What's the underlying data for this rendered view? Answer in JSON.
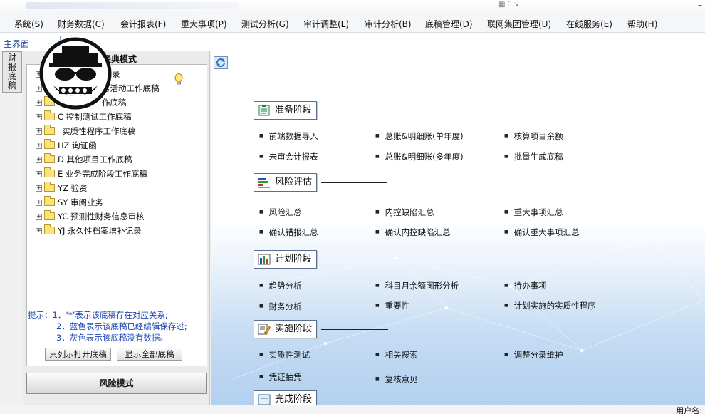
{
  "menu": {
    "items": [
      "系统(S)",
      "财务数据(C)",
      "会计报表(F)",
      "重大事项(P)",
      "测试分析(G)",
      "审计调整(L)",
      "审计分析(B)",
      "底稿管理(D)",
      "联网集团管理(U)",
      "在线服务(E)",
      "帮助(H)"
    ]
  },
  "tabs": {
    "main": "主界面"
  },
  "side_tab": {
    "chars": [
      "财",
      "报",
      "底",
      "稿"
    ]
  },
  "left_panel": {
    "header": "经典模式",
    "tree": [
      "录",
      "务活动工作底稿",
      "作底稿",
      "C 控制测试工作底稿",
      "实质性程序工作底稿",
      "HZ 询证函",
      "D 其他项目工作底稿",
      "E 业务完成阶段工作底稿",
      "YZ 验资",
      "SY 审阅业务",
      "YC 预测性财务信息审核",
      "YJ 永久性档案增补记录"
    ],
    "hints": [
      "提示：1．‘*’表示该底稿存在对应关系;",
      "2．蓝色表示该底稿已经编辑保存过;",
      "3．灰色表示该底稿没有数据。"
    ],
    "btn_open": "只列示打开底稿",
    "btn_all": "显示全部底稿",
    "risk_mode": "风险模式"
  },
  "sections": {
    "prepare": {
      "title": "准备阶段",
      "links": [
        "前端数据导入",
        "总账&明细账(单年度)",
        "核算项目余额",
        "未审会计报表",
        "总账&明细账(多年度)",
        "批量生成底稿"
      ]
    },
    "risk": {
      "title": "风险评估",
      "links": [
        "风险汇总",
        "内控缺陷汇总",
        "重大事项汇总",
        "确认错报汇总",
        "确认内控缺陷汇总",
        "确认重大事项汇总"
      ]
    },
    "plan": {
      "title": "计划阶段",
      "links": [
        "趋势分析",
        "科目月余额图形分析",
        "待办事项",
        "财务分析",
        "重要性",
        "计划实施的实质性程序"
      ]
    },
    "execute": {
      "title": "实施阶段",
      "links": [
        "实质性测试",
        "相关搜索",
        "调整分录维护",
        "凭证抽凭",
        "复核意见"
      ]
    },
    "complete": {
      "title": "完成阶段"
    }
  },
  "status": {
    "user_label": "用户名:"
  },
  "colors": {
    "hint_blue": "#1d45b8",
    "main_gradient_end": "#b3d0ef"
  }
}
